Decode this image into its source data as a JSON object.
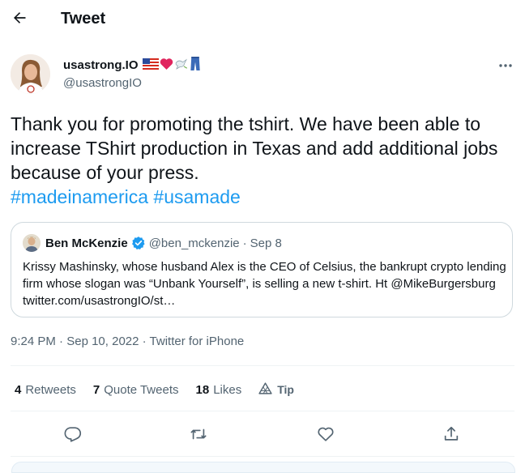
{
  "header": {
    "title": "Tweet",
    "back_icon": "arrow-left-icon"
  },
  "author": {
    "display_name": "usastrong.IO",
    "handle": "@usastrongIO",
    "name_emojis": [
      "us-flag",
      "red-heart",
      "dove",
      "jeans"
    ]
  },
  "tweet": {
    "text": "Thank you for promoting the tshirt. We have been able to increase TShirt production in Texas and add additional jobs because of your press.",
    "hashtags": [
      "#madeinamerica",
      "#usamade"
    ]
  },
  "quote": {
    "name": "Ben McKenzie",
    "handle": "@ben_mckenzie",
    "separator": "·",
    "date": "Sep 8",
    "body": "Krissy Mashinsky, whose husband Alex is the CEO of Celsius, the bankrupt crypto lending firm whose slogan was “Unbank Yourself”, is selling a new t-shirt. Ht @MikeBurgersburg twitter.com/usastrongIO/st…"
  },
  "meta": {
    "time": "9:24 PM",
    "separator": "·",
    "date": "Sep 10, 2022",
    "source": "Twitter for iPhone"
  },
  "stats": {
    "retweets_count": "4",
    "retweets_label": "Retweets",
    "quotes_count": "7",
    "quotes_label": "Quote Tweets",
    "likes_count": "18",
    "likes_label": "Likes",
    "tip_label": "Tip"
  },
  "actions": [
    "reply-icon",
    "retweet-icon",
    "like-icon",
    "share-icon"
  ],
  "colors": {
    "accent": "#1d9bf0",
    "text": "#0f1419",
    "muted": "#536471",
    "border": "#cfd9de",
    "divider": "#eff3f4"
  }
}
